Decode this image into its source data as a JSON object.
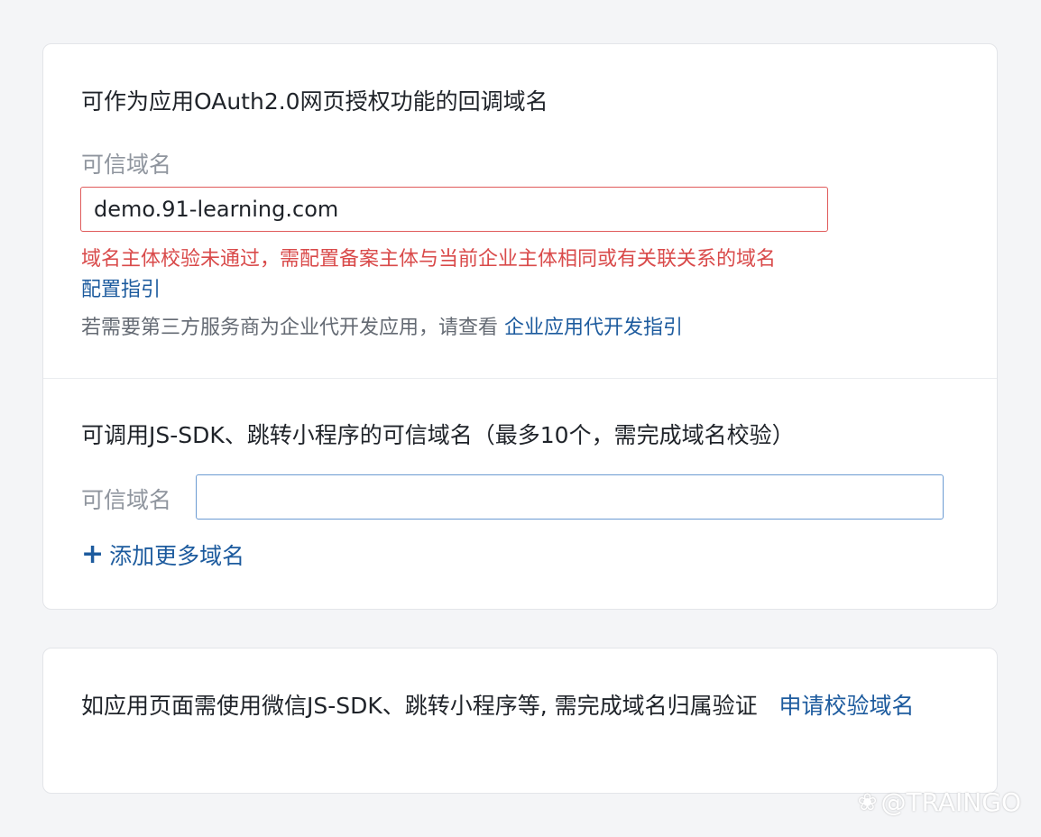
{
  "oauth_section": {
    "title": "可作为应用OAuth2.0网页授权功能的回调域名",
    "field_label": "可信域名",
    "input_value": "demo.91-learning.com",
    "error_message": "域名主体校验未通过，需配置备案主体与当前企业主体相同或有关联关系的域名",
    "config_guide_link": "配置指引",
    "hint_prefix": "若需要第三方服务商为企业代开发应用，请查看 ",
    "hint_link": "企业应用代开发指引"
  },
  "jssdk_section": {
    "title": "可调用JS-SDK、跳转小程序的可信域名（最多10个，需完成域名校验）",
    "field_label": "可信域名",
    "input_value": "",
    "add_more_label": "添加更多域名"
  },
  "verify_section": {
    "text": "如应用页面需使用微信JS-SDK、跳转小程序等, 需完成域名归属验证",
    "link": "申请校验域名"
  },
  "watermark": {
    "text": "@TRAINGO"
  },
  "icons": {
    "add": "plus-icon",
    "watermark": "paw-icon"
  },
  "colors": {
    "link": "#1d5b9e",
    "error": "#d94a4a",
    "error_border": "#e05b5b",
    "focus_border": "#6c9bd2"
  }
}
